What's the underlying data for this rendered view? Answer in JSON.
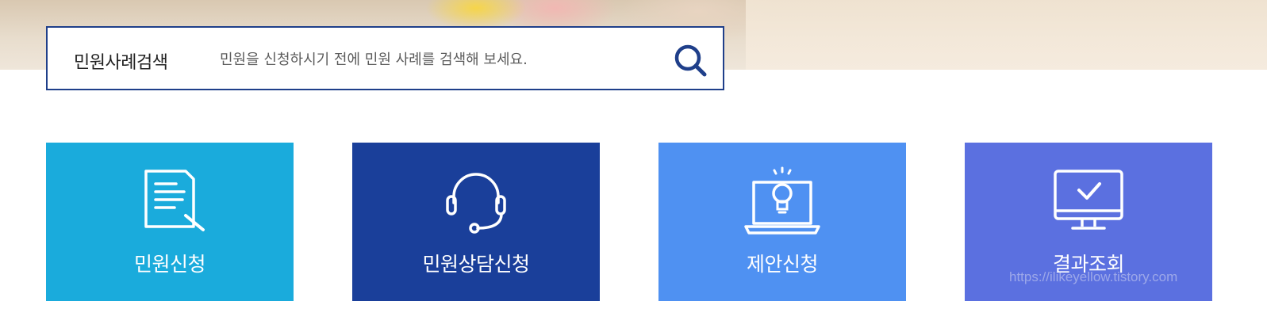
{
  "banner": {
    "image": "seashells-beach-banner"
  },
  "search": {
    "title": "민원사례검색",
    "placeholder": "민원을 신청하시기 전에 민원 사례를 검색해 보세요.",
    "icon": "search-icon",
    "border_color": "#1f3f8a"
  },
  "tiles": [
    {
      "label": "민원신청",
      "icon": "document-icon",
      "color": "#1aabdc"
    },
    {
      "label": "민원상담신청",
      "icon": "headset-icon",
      "color": "#1a3f9a"
    },
    {
      "label": "제안신청",
      "icon": "laptop-lightbulb-icon",
      "color": "#4f91f2"
    },
    {
      "label": "결과조회",
      "icon": "monitor-check-icon",
      "color": "#5b70e0"
    }
  ],
  "watermark": "https://ilikeyellow.tistory.com"
}
